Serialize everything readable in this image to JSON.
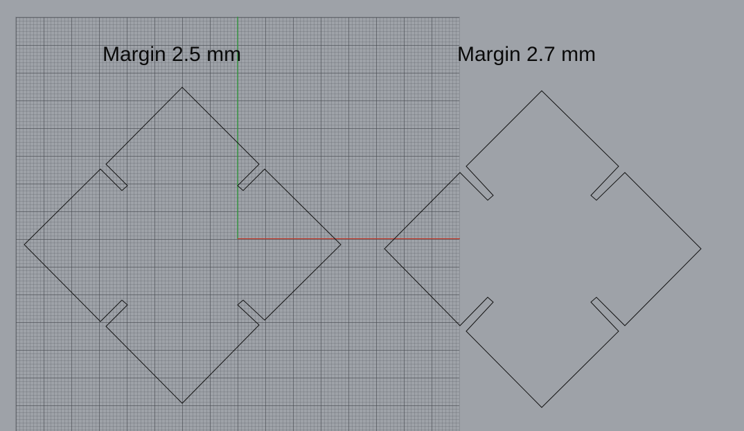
{
  "viewport": {
    "background": "#9ea2a8",
    "grid_color": "#464a50"
  },
  "axes": {
    "x_axis_color": "#c0392b",
    "y_axis_color": "#2e9e3a"
  },
  "labels": {
    "left": "Margin 2.5 mm",
    "right": "Margin 2.7 mm"
  },
  "curves": {
    "stroke_color": "#111111"
  }
}
